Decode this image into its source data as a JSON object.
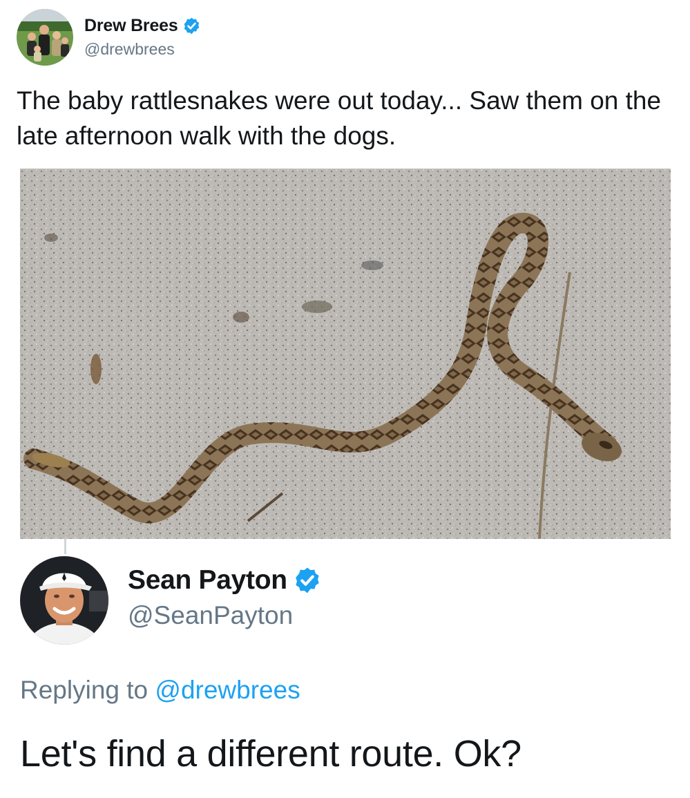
{
  "tweet": {
    "author": {
      "name": "Drew Brees",
      "handle": "@drewbrees",
      "verified": true
    },
    "text": "The baby rattlesnakes were out today... Saw them on the late afternoon walk with the dogs.",
    "media": "photo"
  },
  "reply": {
    "author": {
      "name": "Sean Payton",
      "handle": "@SeanPayton",
      "verified": true
    },
    "replying_prefix": "Replying to",
    "replying_to": "@drewbrees",
    "text": "Let's find a different route. Ok?"
  },
  "colors": {
    "text": "#14171a",
    "secondary": "#657786",
    "link": "#1da1f2",
    "verified": "#1da1f2"
  },
  "icons": {
    "verified": "verified-badge-icon"
  }
}
